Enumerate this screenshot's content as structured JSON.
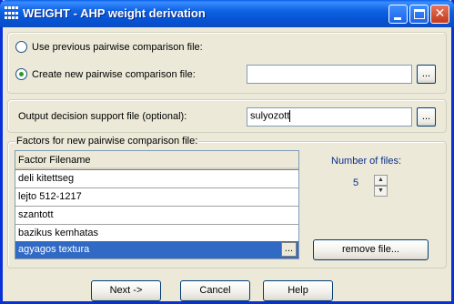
{
  "window": {
    "title": "WEIGHT - AHP weight derivation",
    "controls": {
      "minimize": "minimize",
      "maximize": "maximize",
      "close": "✕"
    }
  },
  "source": {
    "option_use_previous": "Use previous pairwise comparison file:",
    "option_create_new": "Create new pairwise comparison file:",
    "selected": "create_new",
    "new_file_value": "",
    "browse_label": "..."
  },
  "output": {
    "label": "Output decision support file (optional):",
    "value": "sulyozott",
    "browse_label": "..."
  },
  "factors": {
    "group_label": "Factors for new pairwise comparison file:",
    "column_header": "Factor Filename",
    "rows": [
      "deli kitettseg",
      "lejto 512-1217",
      "szantott",
      "bazikus kemhatas",
      "agyagos textura"
    ],
    "selected_index": 4,
    "row_browse_label": "...",
    "number_label": "Number of files:",
    "number_value": "5",
    "spin_up": "▲",
    "spin_down": "▼",
    "remove_button": "remove file..."
  },
  "buttons": {
    "next": "Next ->",
    "cancel": "Cancel",
    "help": "Help"
  },
  "colors": {
    "titlebar": "#0A5FE8",
    "selection": "#316AC5",
    "label_blue": "#0B2F8A",
    "dialog_bg": "#ECE9D8"
  }
}
